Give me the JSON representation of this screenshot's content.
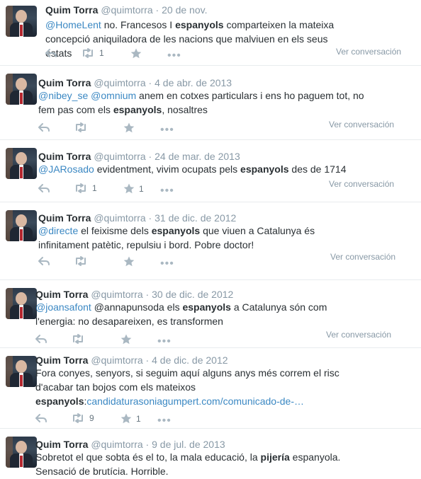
{
  "common": {
    "view_conversation": "Ver conversación",
    "dot": "·"
  },
  "tweets": [
    {
      "name": "Quim Torra",
      "handle": "@quimtorra",
      "date": "20 de nov.",
      "segments": [
        {
          "t": "@HomeLent",
          "c": "mention"
        },
        {
          "t": " no. Francesos I ",
          "c": ""
        },
        {
          "t": "espanyols",
          "c": "bold"
        },
        {
          "t": " comparteixen la mateixa concepció aniquiladora de les nacions que malviuen en els seus estats",
          "c": ""
        }
      ],
      "retweets": "1",
      "favorites": ""
    },
    {
      "name": "Quim Torra",
      "handle": "@quimtorra",
      "date": "4 de abr. de 2013",
      "segments": [
        {
          "t": "@nibey_se",
          "c": "mention"
        },
        {
          "t": " ",
          "c": ""
        },
        {
          "t": "@omnium",
          "c": "mention"
        },
        {
          "t": " anem en cotxes particulars i ens ho paguem tot, no fem pas com els ",
          "c": ""
        },
        {
          "t": "espanyols",
          "c": "bold"
        },
        {
          "t": ", nosaltres",
          "c": ""
        }
      ],
      "retweets": "",
      "favorites": ""
    },
    {
      "name": "Quim Torra",
      "handle": "@quimtorra",
      "date": "24 de mar. de 2013",
      "segments": [
        {
          "t": "@JARosado",
          "c": "mention"
        },
        {
          "t": " evidentment, vivim ocupats pels ",
          "c": ""
        },
        {
          "t": "espanyols",
          "c": "bold"
        },
        {
          "t": " des de 1714",
          "c": ""
        }
      ],
      "retweets": "1",
      "favorites": "1"
    },
    {
      "name": "Quim Torra",
      "handle": "@quimtorra",
      "date": "31 de dic. de 2012",
      "segments": [
        {
          "t": "@directe",
          "c": "mention"
        },
        {
          "t": " el feixisme dels ",
          "c": ""
        },
        {
          "t": "espanyols",
          "c": "bold"
        },
        {
          "t": " que viuen a Catalunya és infinitament patètic, repulsiu i bord. Pobre doctor!",
          "c": ""
        }
      ],
      "retweets": "",
      "favorites": ""
    },
    {
      "name": "Quim Torra",
      "handle": "@quimtorra",
      "date": "30 de dic. de 2012",
      "segments": [
        {
          "t": "@joansafont",
          "c": "mention"
        },
        {
          "t": " @annapunsoda els ",
          "c": ""
        },
        {
          "t": "espanyols",
          "c": "bold"
        },
        {
          "t": " a Catalunya són com l'energia: no desapareixen, es transformen",
          "c": ""
        }
      ],
      "retweets": "",
      "favorites": ""
    },
    {
      "name": "Quim Torra",
      "handle": "@quimtorra",
      "date": "4 de dic. de 2012",
      "segments": [
        {
          "t": "Fora conyes, senyors, si seguim aquí alguns anys més correm el risc d'acabar tan bojos com els mateixos ",
          "c": ""
        },
        {
          "t": "espanyols",
          "c": "bold"
        },
        {
          "t": ":",
          "c": ""
        },
        {
          "t": "candidaturasoniagumpert.com/comunicado-de-…",
          "c": "link"
        }
      ],
      "retweets": "9",
      "favorites": "1"
    },
    {
      "name": "Quim Torra",
      "handle": "@quimtorra",
      "date": "9 de jul. de 2013",
      "segments": [
        {
          "t": "Sobretot el que sobta és el to, la mala educació, la ",
          "c": ""
        },
        {
          "t": "pijería",
          "c": "bold"
        },
        {
          "t": " espanyola. Sensació de brutícia. Horrible.",
          "c": ""
        }
      ],
      "retweets": "",
      "favorites": ""
    }
  ]
}
